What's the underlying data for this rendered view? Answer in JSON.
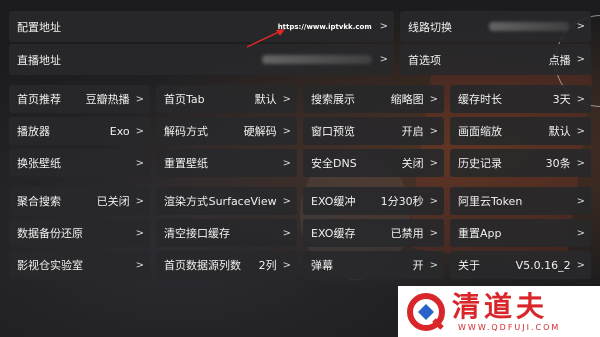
{
  "top": {
    "config_address": {
      "label": "配置地址",
      "value": "https://www.iptvkk.com"
    },
    "line_switch": {
      "label": "线路切换"
    },
    "live_address": {
      "label": "直播地址"
    },
    "preference": {
      "label": "首选项",
      "value": "点播"
    }
  },
  "grid": [
    {
      "id": "homepage-recommend",
      "label": "首页推荐",
      "value": "豆瓣热播"
    },
    {
      "id": "homepage-tab",
      "label": "首页Tab",
      "value": "默认"
    },
    {
      "id": "search-display",
      "label": "搜索展示",
      "value": "缩略图"
    },
    {
      "id": "cache-duration",
      "label": "缓存时长",
      "value": "3天"
    },
    {
      "id": "player",
      "label": "播放器",
      "value": "Exo"
    },
    {
      "id": "decode-mode",
      "label": "解码方式",
      "value": "硬解码"
    },
    {
      "id": "window-preview",
      "label": "窗口预览",
      "value": "开启"
    },
    {
      "id": "screen-zoom",
      "label": "画面缩放",
      "value": "默认"
    },
    {
      "id": "change-wallpaper",
      "label": "换张壁纸",
      "value": ""
    },
    {
      "id": "reset-wallpaper",
      "label": "重置壁纸",
      "value": ""
    },
    {
      "id": "secure-dns",
      "label": "安全DNS",
      "value": "关闭"
    },
    {
      "id": "history",
      "label": "历史记录",
      "value": "30条"
    },
    {
      "id": "aggregate-search",
      "label": "聚合搜索",
      "value": "已关闭"
    },
    {
      "id": "render-mode",
      "label": "渲染方式",
      "value": "SurfaceView"
    },
    {
      "id": "exo-buffer",
      "label": "EXO缓冲",
      "value": "1分30秒"
    },
    {
      "id": "aliyun-token",
      "label": "阿里云Token",
      "value": ""
    },
    {
      "id": "data-backup",
      "label": "数据备份还原",
      "value": ""
    },
    {
      "id": "clear-cache",
      "label": "清空接口缓存",
      "value": ""
    },
    {
      "id": "exo-cache",
      "label": "EXO缓存",
      "value": "已禁用"
    },
    {
      "id": "reset-app",
      "label": "重置App",
      "value": ""
    },
    {
      "id": "lab",
      "label": "影视仓实验室",
      "value": ""
    },
    {
      "id": "homepage-columns",
      "label": "首页数据源列数",
      "value": "2列"
    },
    {
      "id": "danmaku",
      "label": "弹幕",
      "value": "开"
    },
    {
      "id": "about",
      "label": "关于",
      "value": "V5.0.16_2"
    }
  ],
  "chevron": ">",
  "watermark": {
    "cn": "清道夫",
    "en": "WWW.QDFUJI.COM"
  },
  "colors": {
    "card_bg": "#28282a",
    "text": "#f2f2f2",
    "watermark_red": "#d8262b"
  }
}
